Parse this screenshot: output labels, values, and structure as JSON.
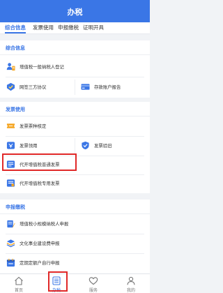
{
  "header": {
    "title": "办税"
  },
  "tabs": [
    {
      "label": "综合信息",
      "active": true
    },
    {
      "label": "发票使用",
      "active": false
    },
    {
      "label": "申报缴税",
      "active": false
    },
    {
      "label": "证明开具",
      "active": false
    }
  ],
  "sections": {
    "general": {
      "title": "综合信息",
      "items": [
        {
          "label": "增值税一般纳税人登记",
          "icon": "user-register-icon"
        },
        {
          "label": "网签三方协议",
          "icon": "handshake-icon"
        },
        {
          "label": "存款账户报告",
          "icon": "bank-card-icon"
        }
      ]
    },
    "invoice": {
      "title": "发票使用",
      "items": [
        {
          "label": "发票票种核定",
          "icon": "ticket-icon"
        },
        {
          "label": "发票领用",
          "icon": "invoice-receive-icon"
        },
        {
          "label": "发票验旧",
          "icon": "verify-icon"
        },
        {
          "label": "代开增值税普通发票",
          "icon": "invoice-issue-icon",
          "highlighted": true
        },
        {
          "label": "代开增值税专用发票",
          "icon": "invoice-special-icon"
        }
      ]
    },
    "declare": {
      "title": "申报缴税",
      "items": [
        {
          "label": "增值税小规模纳税人申报",
          "icon": "report-icon"
        },
        {
          "label": "文化事业建设费申报",
          "icon": "stack-icon"
        },
        {
          "label": "定期定额户自行申报",
          "icon": "calendar-icon"
        }
      ]
    }
  },
  "bottom_nav": [
    {
      "label": "首页",
      "icon": "home-icon",
      "active": false
    },
    {
      "label": "办税",
      "icon": "tax-list-icon",
      "active": true
    },
    {
      "label": "服务",
      "icon": "heart-icon",
      "active": false
    },
    {
      "label": "我的",
      "icon": "profile-icon",
      "active": false
    }
  ],
  "colors": {
    "accent": "#3a76e6",
    "highlight": "#e02828",
    "background": "#f1f3f6"
  }
}
